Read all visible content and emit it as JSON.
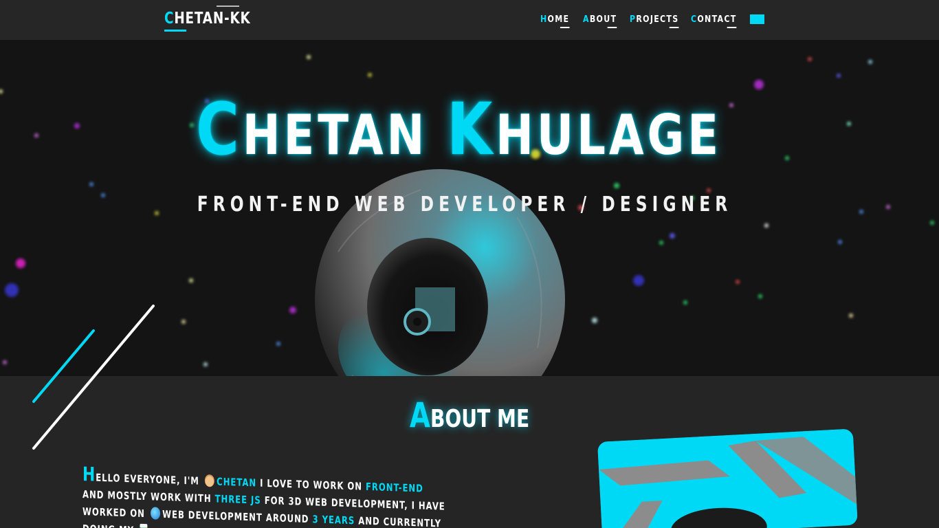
{
  "nav": {
    "logo_first": "C",
    "logo_rest": "HETAN-KK",
    "links": [
      {
        "first": "H",
        "rest": "OME"
      },
      {
        "first": "A",
        "rest": "BOUT"
      },
      {
        "first": "P",
        "rest": "ROJECTS"
      },
      {
        "first": "C",
        "rest": "ONTACT"
      }
    ]
  },
  "hero": {
    "title_first_initial": "C",
    "title_first_rest": "HETAN",
    "title_last_initial": "K",
    "title_last_rest": "HULAGE",
    "subtitle": "FRONT-END WEB DEVELOPER / DESIGNER"
  },
  "about": {
    "title_initial": "A",
    "title_rest": "BOUT ME",
    "text": {
      "drop": "H",
      "p1": "ELLO EVERYONE, I'M",
      "name": "CHETAN",
      "p2": "I LOVE TO WORK ON",
      "hl1": "FRONT-END",
      "p3": "AND MOSTLY WORK WITH",
      "hl2": "THREE JS",
      "p4": "FOR 3D WEB DEVELOPMENT, I HAVE WORKED ON",
      "p5": "WEB DEVELOPMENT AROUND",
      "hl3": "3 YEARS",
      "p6": "AND CURRENTLY DOING MY"
    }
  },
  "colors": {
    "accent": "#00d9f5",
    "nav_bg": "#262626",
    "hero_bg": "#141414",
    "about_bg": "#252525"
  },
  "icons": [
    "menu-toggle-icon",
    "face-emoji-icon",
    "globe-emoji-icon",
    "books-emoji-icon"
  ]
}
